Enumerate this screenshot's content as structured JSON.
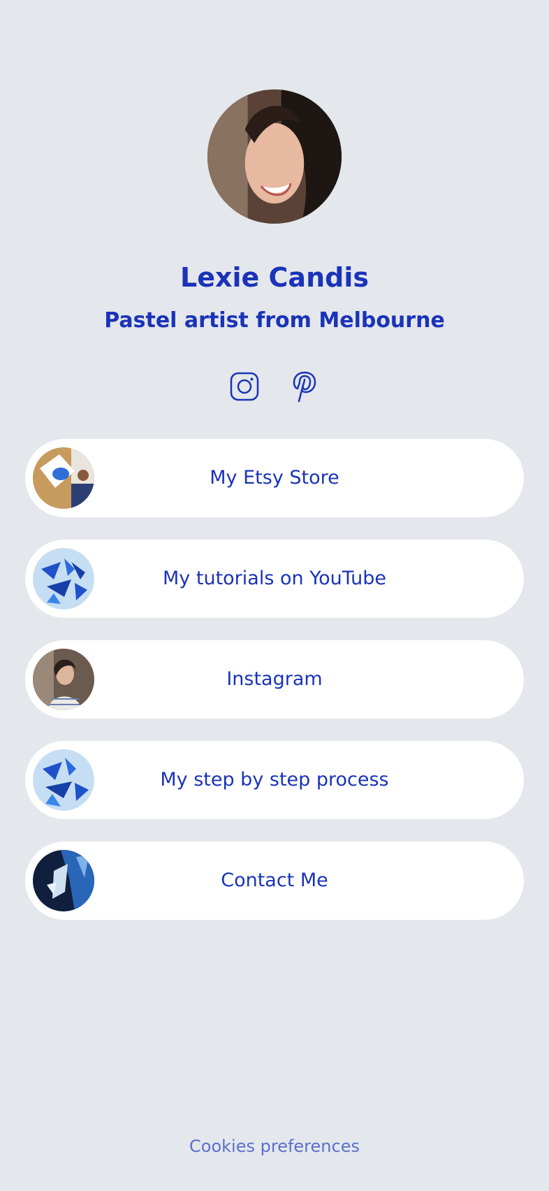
{
  "profile": {
    "name": "Lexie Candis",
    "subtitle": "Pastel artist from Melbourne"
  },
  "socials": [
    {
      "icon": "instagram-icon"
    },
    {
      "icon": "pinterest-icon"
    }
  ],
  "links": [
    {
      "label": "My Etsy Store"
    },
    {
      "label": "My tutorials on YouTube"
    },
    {
      "label": "Instagram"
    },
    {
      "label": "My step by step process"
    },
    {
      "label": "Contact Me"
    }
  ],
  "footer": {
    "cookies_label": "Cookies preferences"
  },
  "colors": {
    "background": "#e4e7eb",
    "accent": "#1a33b8",
    "card": "#ffffff",
    "footer_text": "#5b70cc"
  }
}
